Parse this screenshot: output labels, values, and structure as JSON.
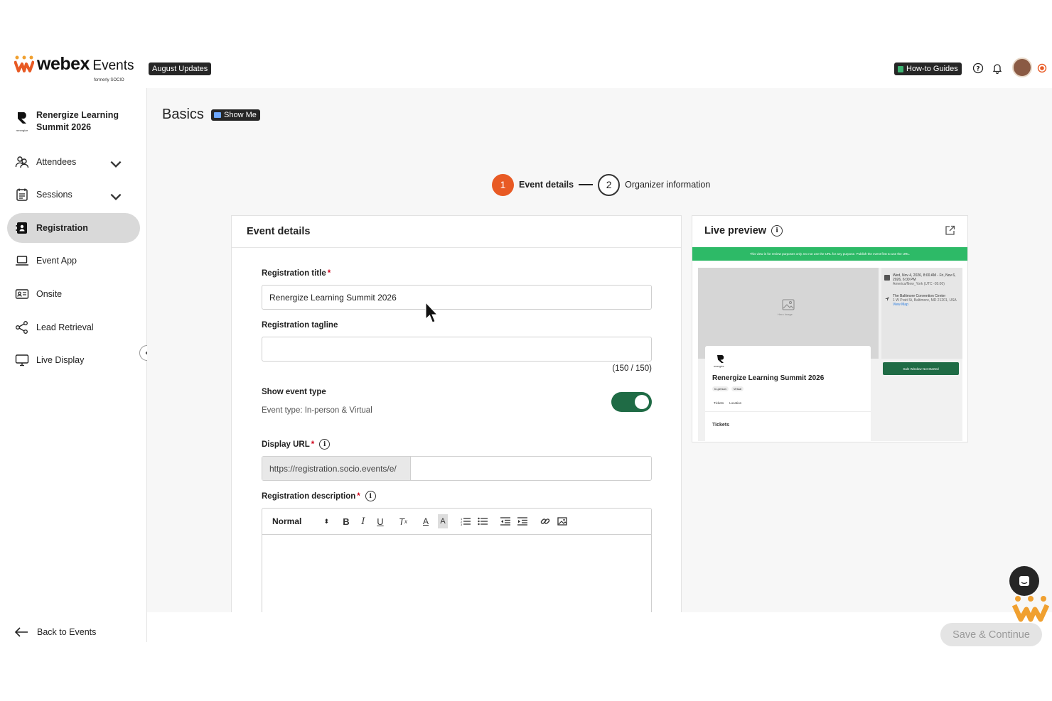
{
  "header": {
    "logo_word": "webex",
    "logo_product": "Events",
    "logo_formerly": "formerly SOCIO",
    "updates_tag": "August Updates",
    "guides_label": "How-to Guides",
    "icons": [
      "help-icon",
      "bell-icon",
      "avatar",
      "record-icon"
    ]
  },
  "sidebar": {
    "event_name_line1": "Renergize Learning",
    "event_name_line2": "Summit 2026",
    "event_logo_text": "renergize",
    "items": [
      {
        "label": "Attendees",
        "icon": "attendees-icon",
        "expandable": true
      },
      {
        "label": "Sessions",
        "icon": "sessions-icon",
        "expandable": true
      },
      {
        "label": "Registration",
        "icon": "registration-icon",
        "active": true
      },
      {
        "label": "Event App",
        "icon": "laptop-icon"
      },
      {
        "label": "Onsite",
        "icon": "badge-icon"
      },
      {
        "label": "Lead Retrieval",
        "icon": "share-icon"
      },
      {
        "label": "Live Display",
        "icon": "monitor-icon"
      }
    ],
    "back_label": "Back to Events"
  },
  "main": {
    "title": "Basics",
    "show_me": "Show Me",
    "steps": [
      {
        "num": "1",
        "label": "Event details",
        "active": true
      },
      {
        "num": "2",
        "label": "Organizer information",
        "active": false
      }
    ],
    "details": {
      "heading": "Event details",
      "reg_title_label": "Registration title",
      "reg_title_value": "Renergize Learning Summit 2026",
      "tagline_label": "Registration tagline",
      "tagline_value": "",
      "tagline_counter": "(150 / 150)",
      "event_type_label": "Show event type",
      "event_type_value": "Event type: In-person & Virtual",
      "event_type_on": true,
      "url_label": "Display URL",
      "url_prefix": "https://registration.socio.events/e/",
      "url_value": "",
      "desc_label": "Registration description",
      "editor_format": "Normal"
    },
    "preview": {
      "heading": "Live preview",
      "banner": "This view is for review purposes only. Do not use the URL for any purpose. Publish the event first to use the URL.",
      "date_text": "Wed, Nov 4, 2026, 8:00 AM - Fri, Nov 6, 2026, 6:00 PM",
      "timezone_text": "America/New_York (UTC -05:00)",
      "venue_text": "The Baltimore Convention Center",
      "address_text": "1 W Pratt St, Baltimore, MD 21201, USA",
      "view_map": "View Map",
      "image_caption": "Hero Image",
      "button_text": "Sale Window Not Started",
      "event_title": "Renergize Learning Summit 2026",
      "badge_in_person": "In-person",
      "badge_virtual": "Virtual",
      "tab_tickets": "Tickets",
      "tab_location": "Location",
      "section_tickets": "Tickets",
      "logo_text": "renergize"
    }
  },
  "footer": {
    "save_label": "Save & Continue"
  },
  "colors": {
    "accent_orange": "#e85a24",
    "toggle_green": "#1f6b45",
    "preview_banner": "#2dba67",
    "active_nav_bg": "#d9d9d9"
  }
}
